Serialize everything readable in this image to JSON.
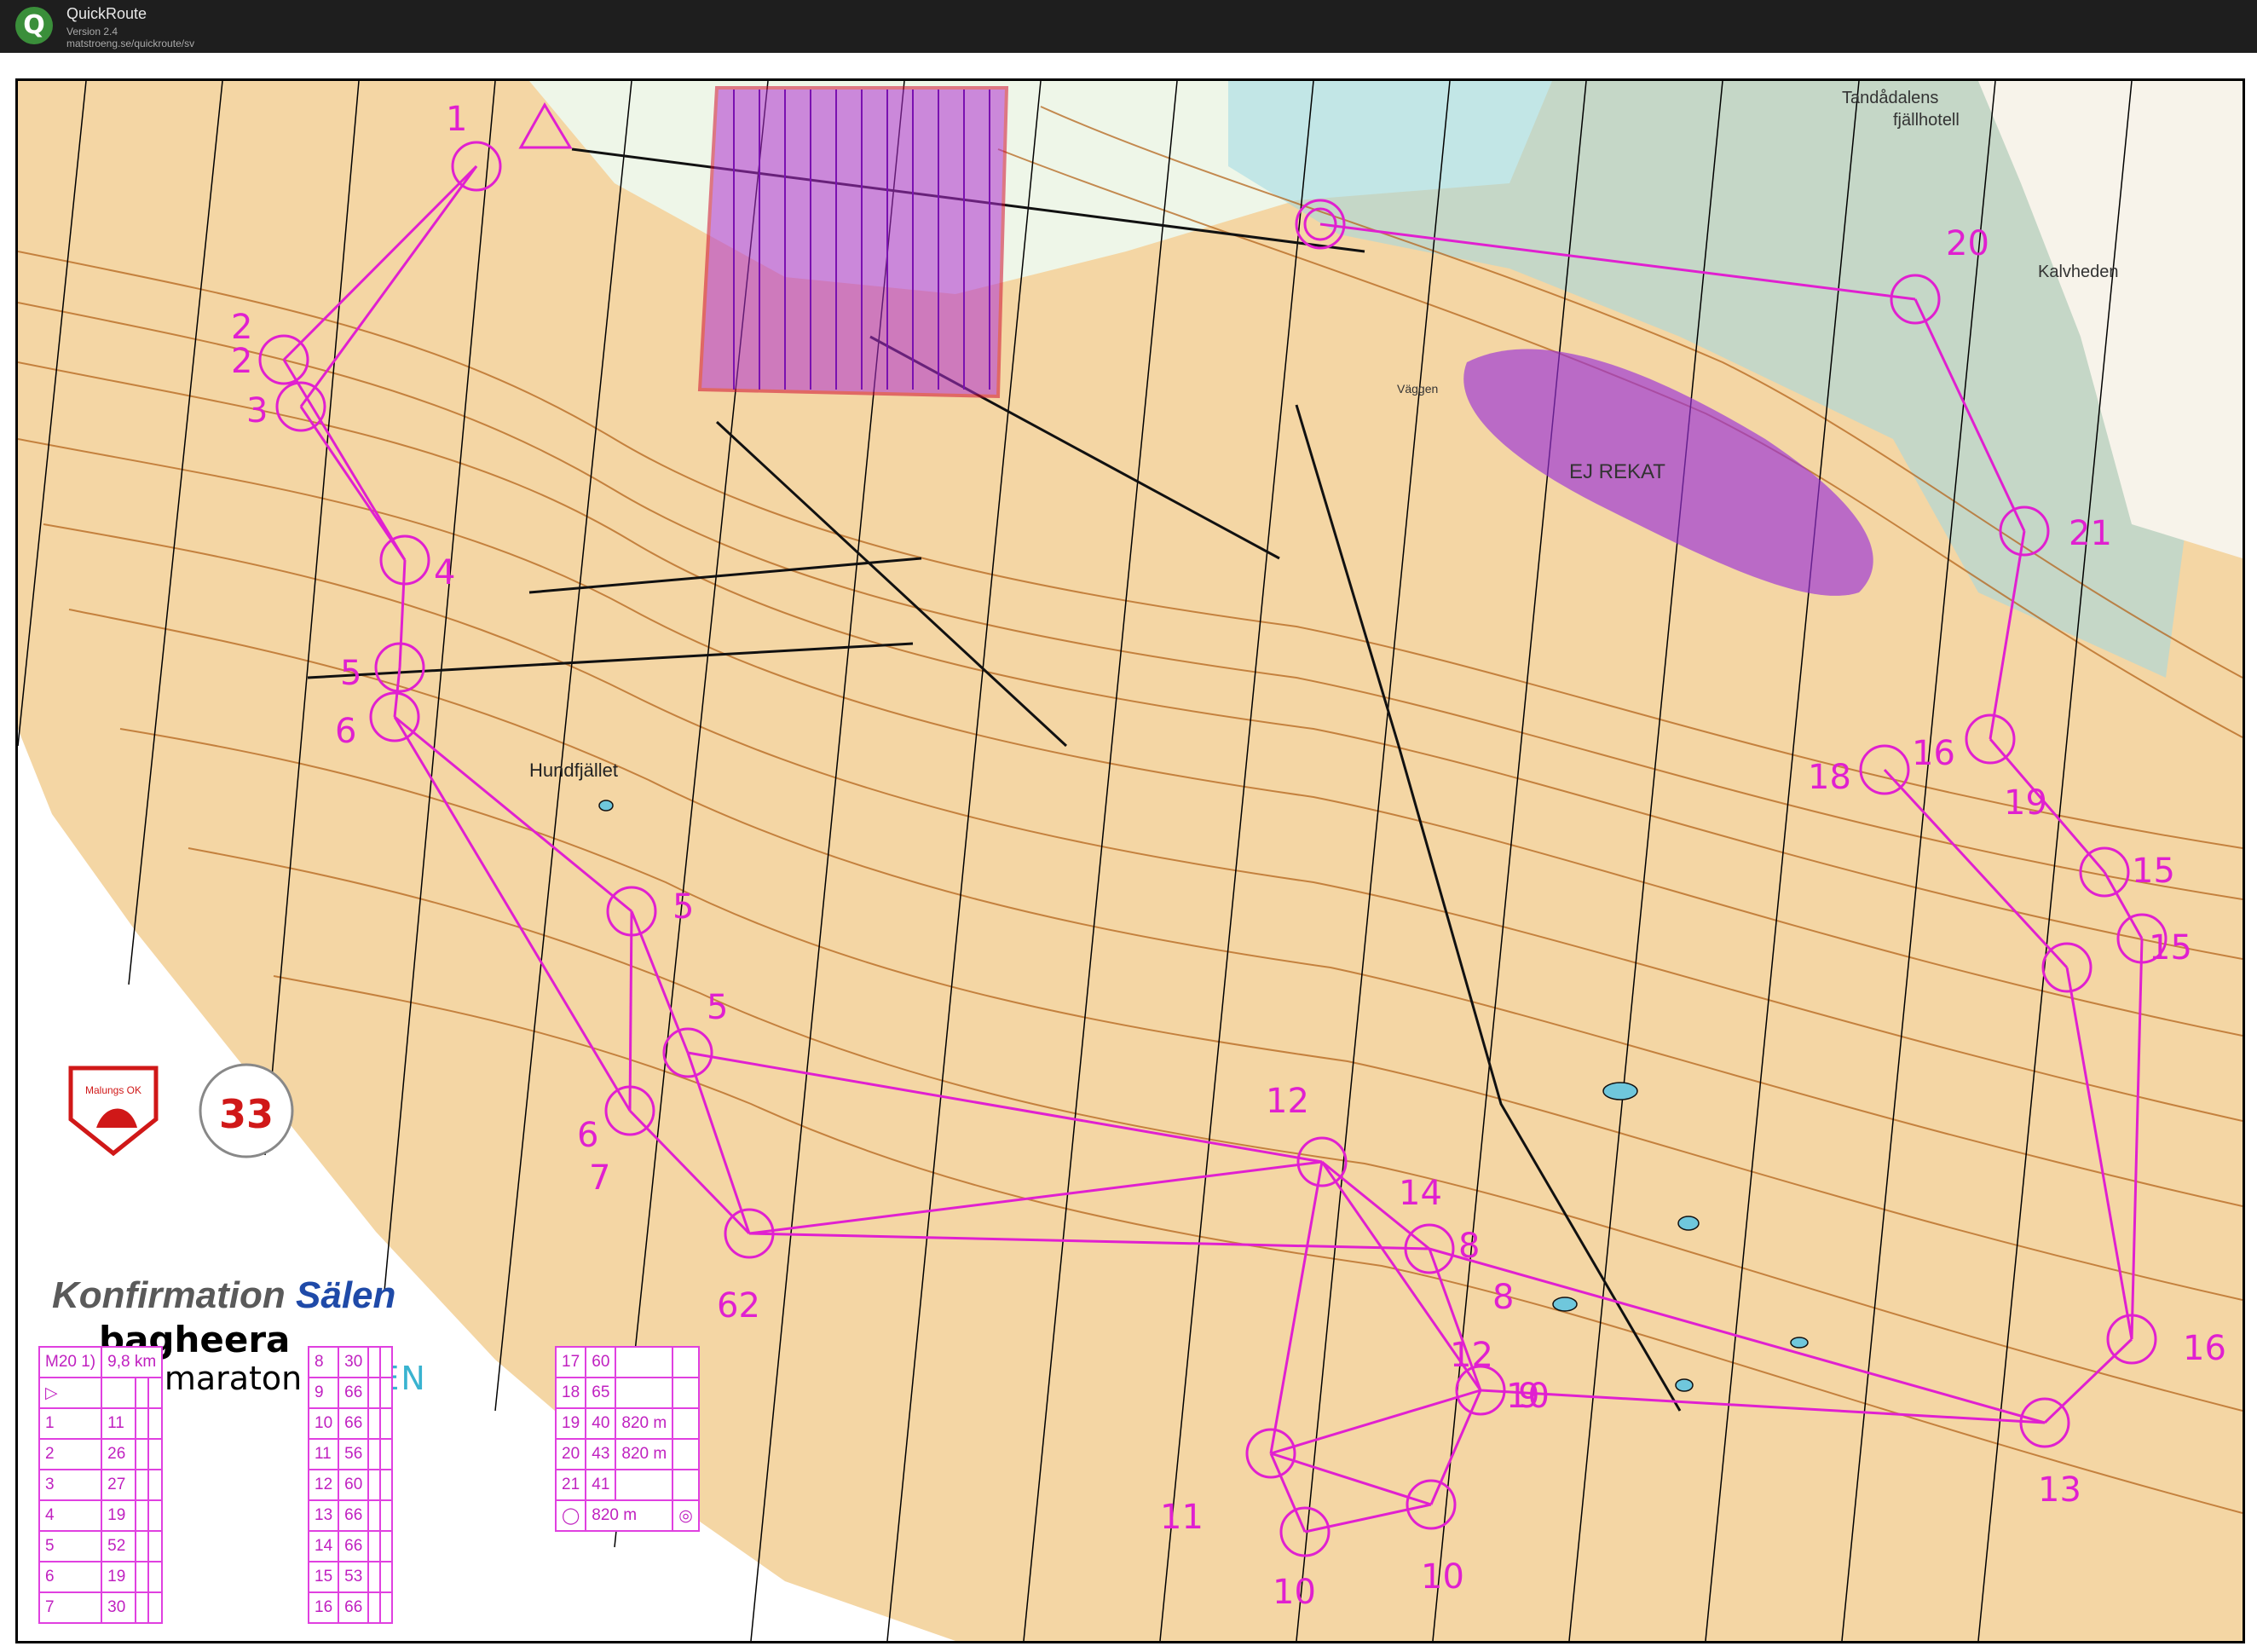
{
  "app": {
    "title": "QuickRoute",
    "version": "Version 2.4",
    "url": "matstroeng.se/quickroute/sv",
    "icon": "Q"
  },
  "map_labels": {
    "hundfjallet": "Hundfjället",
    "ej_rekat": "EJ REKAT",
    "tandadalen": "Tandådalens",
    "fjallhotell": "fjällhotell",
    "kalvheden": "Kalvheden",
    "vaggen": "Väggen"
  },
  "sponsors": {
    "konfirmation": "Konfirmation",
    "salen": "Sälen",
    "bagheera": "bagheera",
    "fjallmaraton": "Fjällmaraton",
    "fjall_salen": "SÄLEN",
    "club_logo": "Malungs OK",
    "badge": "33"
  },
  "control_labels": [
    {
      "id": "c1",
      "text": "1"
    },
    {
      "id": "c2",
      "text": "2"
    },
    {
      "id": "c2b",
      "text": "2"
    },
    {
      "id": "c3",
      "text": "3"
    },
    {
      "id": "c4",
      "text": "4"
    },
    {
      "id": "c5a",
      "text": "5"
    },
    {
      "id": "c5b",
      "text": "5"
    },
    {
      "id": "c5c",
      "text": "5"
    },
    {
      "id": "c6a",
      "text": "6"
    },
    {
      "id": "c6b",
      "text": "6"
    },
    {
      "id": "c7",
      "text": "7"
    },
    {
      "id": "c12a",
      "text": "12"
    },
    {
      "id": "c14",
      "text": "14"
    },
    {
      "id": "c8a",
      "text": "8"
    },
    {
      "id": "c8b",
      "text": "8"
    },
    {
      "id": "c12b",
      "text": "12"
    },
    {
      "id": "c9a",
      "text": "9"
    },
    {
      "id": "c10a",
      "text": "10"
    },
    {
      "id": "c11",
      "text": "11"
    },
    {
      "id": "c10b",
      "text": "10"
    },
    {
      "id": "c10c",
      "text": "10"
    },
    {
      "id": "c18",
      "text": "18"
    },
    {
      "id": "c16",
      "text": "16"
    },
    {
      "id": "c19",
      "text": "19"
    },
    {
      "id": "c15a",
      "text": "15"
    },
    {
      "id": "c15b",
      "text": "15"
    },
    {
      "id": "c16b",
      "text": "16"
    },
    {
      "id": "c13",
      "text": "13"
    },
    {
      "id": "c20",
      "text": "20"
    },
    {
      "id": "c21",
      "text": "21"
    },
    {
      "id": "c62",
      "text": "62"
    }
  ],
  "legend": {
    "header": "M20 1)",
    "distance": "9,8 km",
    "col1": [
      [
        "1",
        "11"
      ],
      [
        "2",
        "26"
      ],
      [
        "3",
        "27"
      ],
      [
        "4",
        "19"
      ],
      [
        "5",
        "52"
      ],
      [
        "6",
        "19"
      ],
      [
        "7",
        "30"
      ]
    ],
    "col2": [
      [
        "8",
        "30"
      ],
      [
        "9",
        "66"
      ],
      [
        "10",
        "66"
      ],
      [
        "11",
        "56"
      ],
      [
        "12",
        "60"
      ],
      [
        "13",
        "66"
      ],
      [
        "14",
        "66"
      ],
      [
        "15",
        "53"
      ],
      [
        "16",
        "66"
      ]
    ],
    "col3": [
      [
        "17",
        "60"
      ],
      [
        "18",
        "65"
      ],
      [
        "19",
        "40",
        "820 m"
      ],
      [
        "20",
        "43",
        "820 m"
      ],
      [
        "21",
        "41",
        ""
      ]
    ],
    "finish": "820 m"
  },
  "colors": {
    "course": "#e020d0",
    "terrain": "#f4d6a4",
    "contour": "#b5651d",
    "forbidden": "#8b1fcf",
    "water": "#8fd3e0"
  }
}
